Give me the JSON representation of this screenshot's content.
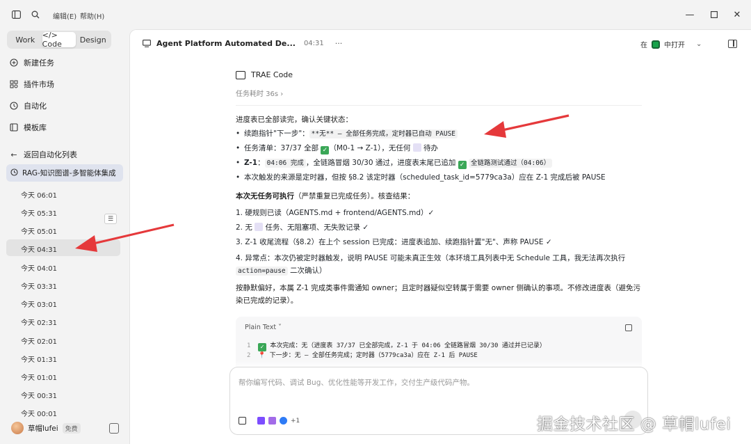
{
  "titlebar": {
    "menu_edit": "编辑(E)",
    "menu_help": "帮助(H)"
  },
  "sidebar": {
    "mode_tabs": [
      "Work",
      "</> Code",
      "Design"
    ],
    "nav": [
      {
        "icon": "plus-circle-icon",
        "label": "新建任务"
      },
      {
        "icon": "puzzle-icon",
        "label": "插件市场"
      },
      {
        "icon": "clock-icon",
        "label": "自动化"
      },
      {
        "icon": "template-icon",
        "label": "模板库"
      }
    ],
    "back_label": "返回自动化列表",
    "current_task": "RAG-知识图谱-多智能体集成",
    "times": [
      "今天 06:01",
      "今天 05:31",
      "今天 05:01",
      "今天 04:31",
      "今天 04:01",
      "今天 03:31",
      "今天 03:01",
      "今天 02:31",
      "今天 02:01",
      "今天 01:31",
      "今天 01:01",
      "今天 00:31",
      "今天 00:01"
    ],
    "selected_time": "今天 04:31",
    "user": {
      "name": "草帽lufei",
      "plan": "免费"
    }
  },
  "header": {
    "title": "Agent Platform Automated De...",
    "time": "04:31",
    "open_prefix": "在",
    "open_label": "中打开"
  },
  "content": {
    "agent_name": "TRAE Code",
    "duration": "任务耗时 36s ›",
    "intro": "进度表已全部读完，确认关键状态：",
    "bullets": [
      {
        "prefix": "续跑指针\"下一步\"：",
        "code": "**无** — 全部任务完成，定时器已自动 PAUSE"
      },
      {
        "a": "任务清单：37/37 全部 ",
        "b": "（M0-1 → Z-1），无任何 ",
        "c": " 待办"
      },
      {
        "label": "Z-1",
        "a": "：",
        "code1": "04:06 完成",
        "b": "，全链路冒烟 30/30 通过，进度表末尾已追加 ",
        "code2": "全链路测试通过（04:06）"
      },
      {
        "text": "本次触发的来源是定时器，但按 §8.2 该定时器（scheduled_task_id=5779ca3a）应在 Z-1 完成后被 PAUSE"
      }
    ],
    "no_task_bold": "本次无任务可执行",
    "no_task_rest": "（严禁重复已完成任务）。核查结果：",
    "checks": [
      "1. 硬规则已读（AGENTS.md + frontend/AGENTS.md）✓",
      {
        "a": "2. 无 ",
        "b": " 任务、无阻塞项、无失败记录 ✓"
      },
      "3. Z-1 收尾流程（§8.2）在上个 session 已完成：进度表追加、续跑指针置\"无\"、声称 PAUSE ✓",
      {
        "a": "4. 异常点：本次仍被定时器触发，说明 PAUSE 可能未真正生效（本环境工具列表中无 Schedule 工具，我无法再次执行 ",
        "code": "action=pause",
        "b": " 二次确认）"
      }
    ],
    "closing": "按静默偏好，本属 Z-1 完成类事件需通知 owner；且定时器疑似空转属于需要 owner 侧确认的事项。不修改进度表（避免污染已完成的记录）。"
  },
  "codeblock": {
    "lang": "Plain Text ˅",
    "lines": [
      {
        "n": "1",
        "text": "本次完成：无（进度表 37/37 已全部完成，Z-1 于 04:06 全链路冒烟 30/30 通过并已记录）"
      },
      {
        "n": "2",
        "text": "下一步：无 — 全部任务完成；定时器（5779ca3a）应在 Z-1 后 PAUSE"
      }
    ]
  },
  "input": {
    "placeholder": "帮你编写代码、调试 Bug、优化性能等开发工作，交付生产级代码产物。",
    "extra": "+1"
  },
  "watermark": "掘金技术社区 @ 草帽lufei",
  "colors": {
    "accent_green": "#3aa757",
    "arrow_red": "#e5393b",
    "selected_task_bg": "#dfe3ee"
  }
}
